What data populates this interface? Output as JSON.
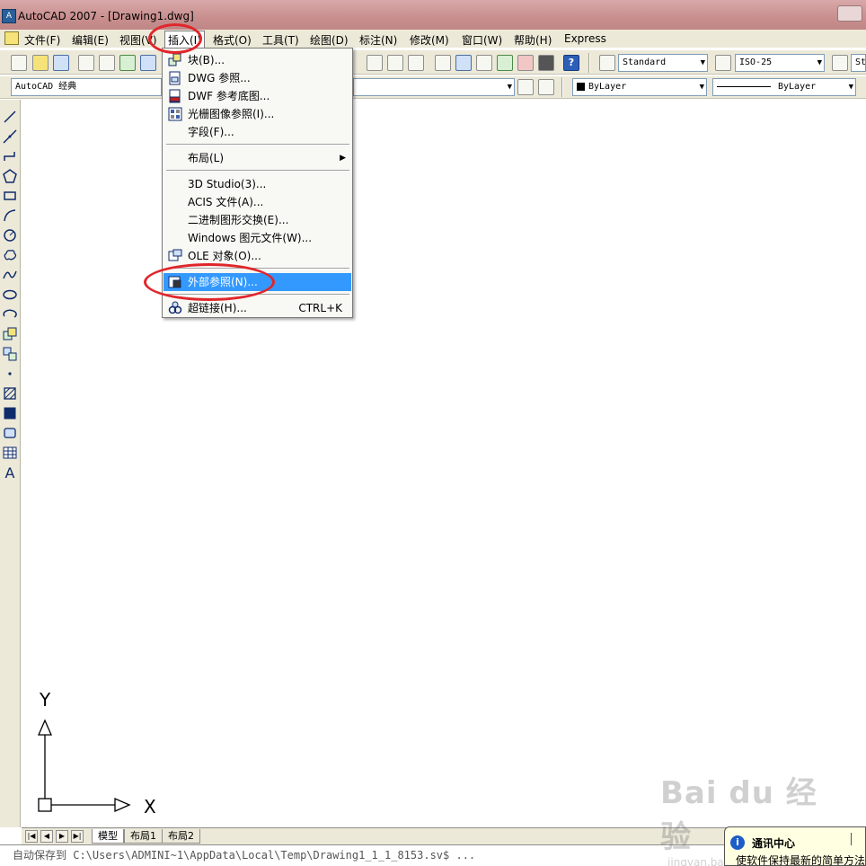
{
  "window": {
    "title": "AutoCAD 2007 - [Drawing1.dwg]"
  },
  "menubar": {
    "items": [
      {
        "label": "文件(F)"
      },
      {
        "label": "编辑(E)"
      },
      {
        "label": "视图(V)"
      },
      {
        "label": "插入(I)"
      },
      {
        "label": "格式(O)"
      },
      {
        "label": "工具(T)"
      },
      {
        "label": "绘图(D)"
      },
      {
        "label": "标注(N)"
      },
      {
        "label": "修改(M)"
      },
      {
        "label": "窗口(W)"
      },
      {
        "label": "帮助(H)"
      },
      {
        "label": "Express"
      }
    ],
    "active_item": "插入(I)"
  },
  "toolbar": {
    "text_style": "Standard",
    "dim_style": "ISO-25",
    "table_style_partial": "St",
    "workspace": "AutoCAD 经典",
    "color": "ByLayer",
    "linetype": "ByLayer"
  },
  "insert_menu": {
    "items": [
      {
        "label": "块(B)...",
        "icon": "block-insert-icon"
      },
      {
        "label": "DWG 参照...",
        "icon": "dwg-reference-icon"
      },
      {
        "label": "DWF 参考底图...",
        "icon": "dwf-underlay-icon"
      },
      {
        "label": "光栅图像参照(I)...",
        "icon": "raster-image-icon"
      },
      {
        "label": "字段(F)..."
      },
      {
        "label": "布局(L)",
        "has_submenu": true
      },
      {
        "label": "3D Studio(3)..."
      },
      {
        "label": "ACIS 文件(A)..."
      },
      {
        "label": "二进制图形交换(E)..."
      },
      {
        "label": "Windows 图元文件(W)..."
      },
      {
        "label": "OLE 对象(O)...",
        "icon": "ole-object-icon"
      },
      {
        "label": "外部参照(N)...",
        "icon": "external-reference-icon",
        "highlighted": true
      },
      {
        "label": "超链接(H)...",
        "icon": "hyperlink-icon",
        "shortcut": "CTRL+K"
      }
    ]
  },
  "ucs": {
    "x_label": "X",
    "y_label": "Y"
  },
  "layout_tabs": {
    "tabs": [
      "模型",
      "布局1",
      "布局2"
    ],
    "active": "模型"
  },
  "command_line": {
    "text": "自动保存到 C:\\Users\\ADMINI~1\\AppData\\Local\\Temp\\Drawing1_1_1_8153.sv$ ..."
  },
  "comm_center": {
    "title": "通讯中心",
    "message": "使软件保持最新的简单方法"
  },
  "watermark": {
    "main": "Bai du 经验",
    "sub": "jingyan.baidu.com"
  },
  "colors": {
    "highlight": "#3399ff",
    "annotation_red": "#e0262b",
    "chrome": "#ece9d8"
  }
}
